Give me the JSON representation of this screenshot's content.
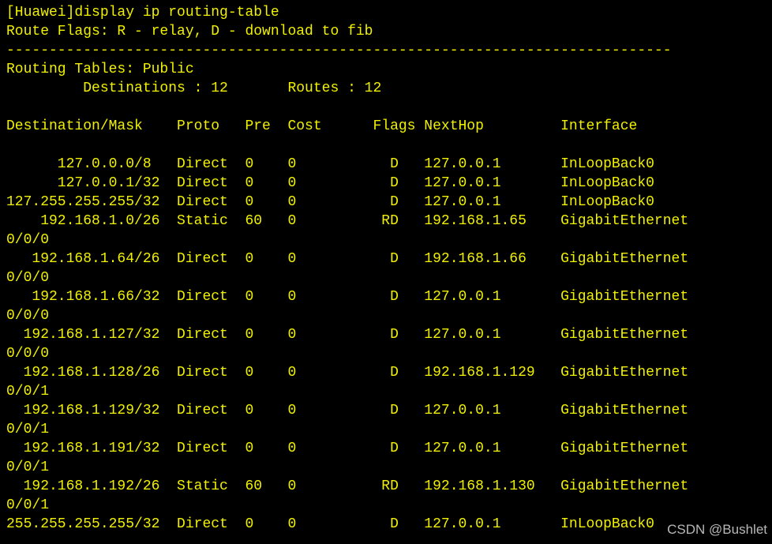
{
  "terminal": {
    "command": "[Huawei]display ip routing-table",
    "flags_legend": "Route Flags: R - relay, D - download to fib",
    "separator": "------------------------------------------------------------------------------",
    "table_title": "Routing Tables: Public",
    "summary": "         Destinations : 12       Routes : 12",
    "header": "Destination/Mask    Proto   Pre  Cost      Flags NextHop         Interface",
    "rows": [
      "      127.0.0.0/8   Direct  0    0           D   127.0.0.1       InLoopBack0",
      "      127.0.0.1/32  Direct  0    0           D   127.0.0.1       InLoopBack0",
      "127.255.255.255/32  Direct  0    0           D   127.0.0.1       InLoopBack0",
      "    192.168.1.0/26  Static  60   0          RD   192.168.1.65    GigabitEthernet",
      "0/0/0",
      "   192.168.1.64/26  Direct  0    0           D   192.168.1.66    GigabitEthernet",
      "0/0/0",
      "   192.168.1.66/32  Direct  0    0           D   127.0.0.1       GigabitEthernet",
      "0/0/0",
      "  192.168.1.127/32  Direct  0    0           D   127.0.0.1       GigabitEthernet",
      "0/0/0",
      "  192.168.1.128/26  Direct  0    0           D   192.168.1.129   GigabitEthernet",
      "0/0/1",
      "  192.168.1.129/32  Direct  0    0           D   127.0.0.1       GigabitEthernet",
      "0/0/1",
      "  192.168.1.191/32  Direct  0    0           D   127.0.0.1       GigabitEthernet",
      "0/0/1",
      "  192.168.1.192/26  Static  60   0          RD   192.168.1.130   GigabitEthernet",
      "0/0/1",
      "255.255.255.255/32  Direct  0    0           D   127.0.0.1       InLoopBack0"
    ]
  },
  "watermark": "CSDN @Bushlet",
  "colors": {
    "background": "#000000",
    "text": "#f0f000"
  }
}
